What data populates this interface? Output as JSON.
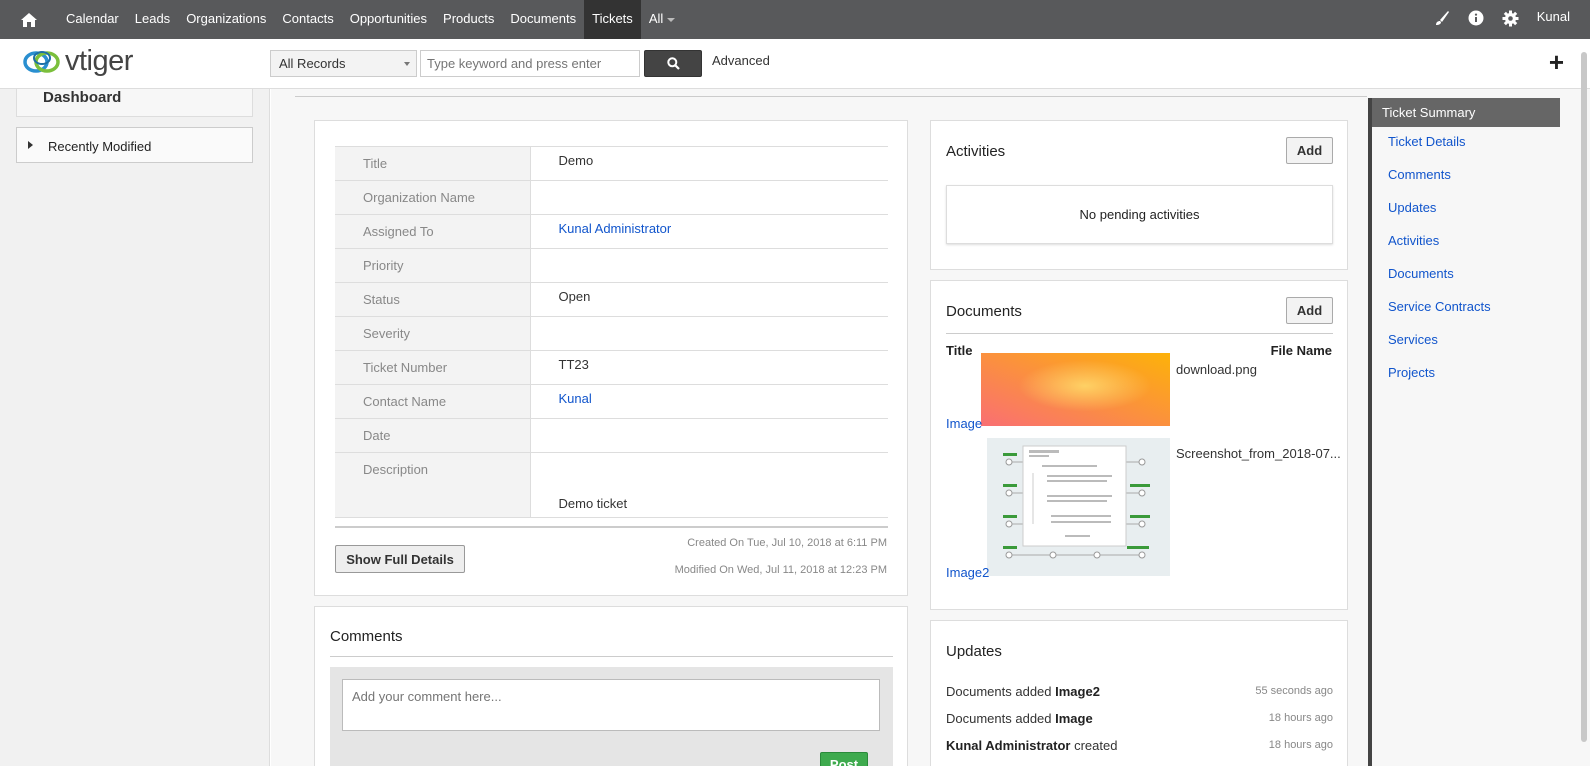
{
  "nav": {
    "items": [
      "Calendar",
      "Leads",
      "Organizations",
      "Contacts",
      "Opportunities",
      "Products",
      "Documents",
      "Tickets"
    ],
    "all_label": "All",
    "active": "Tickets",
    "user": "Kunal"
  },
  "header": {
    "logo_text": "vtiger",
    "scope": "All Records",
    "search_placeholder": "Type keyword and press enter",
    "advanced": "Advanced"
  },
  "sidebar": {
    "dashboard": "Dashboard",
    "recent": "Recently Modified"
  },
  "details": {
    "rows": [
      {
        "label": "Title",
        "value": "Demo"
      },
      {
        "label": "Organization Name",
        "value": ""
      },
      {
        "label": "Assigned To",
        "value": "Kunal Administrator"
      },
      {
        "label": "Priority",
        "value": ""
      },
      {
        "label": "Status",
        "value": "Open"
      },
      {
        "label": "Severity",
        "value": ""
      },
      {
        "label": "Ticket Number",
        "value": "TT23"
      },
      {
        "label": "Contact Name",
        "value": "Kunal"
      },
      {
        "label": "Date",
        "value": ""
      },
      {
        "label": "Description",
        "value": "Demo ticket"
      }
    ],
    "show_full": "Show Full Details",
    "created": "Created On Tue, Jul 10, 2018 at 6:11 PM",
    "modified": "Modified On Wed, Jul 11, 2018 at 12:23 PM"
  },
  "comments": {
    "title": "Comments",
    "placeholder": "Add your comment here...",
    "post": "Post"
  },
  "activities": {
    "title": "Activities",
    "add": "Add",
    "empty": "No pending activities"
  },
  "documents": {
    "title": "Documents",
    "add": "Add",
    "col_title": "Title",
    "col_file": "File Name",
    "items": [
      {
        "title": "Image",
        "file": "download.png"
      },
      {
        "title": "Image2",
        "file": "Screenshot_from_2018-07..."
      }
    ]
  },
  "updates": {
    "title": "Updates",
    "items": [
      {
        "prefix": "Documents added ",
        "bold": "Image2",
        "suffix": "",
        "when": "55 seconds ago"
      },
      {
        "prefix": "Documents added ",
        "bold": "Image",
        "suffix": "",
        "when": "18 hours ago"
      },
      {
        "prefix": "",
        "bold": "Kunal Administrator",
        "suffix": " created",
        "when": "18 hours ago"
      }
    ]
  },
  "summary": {
    "head": "Ticket Summary",
    "links": [
      "Ticket Details",
      "Comments",
      "Updates",
      "Activities",
      "Documents",
      "Service Contracts",
      "Services",
      "Projects"
    ]
  },
  "colors": {
    "nav_bg": "#58595b",
    "link": "#15c",
    "post_green": "#3eaa4e"
  }
}
